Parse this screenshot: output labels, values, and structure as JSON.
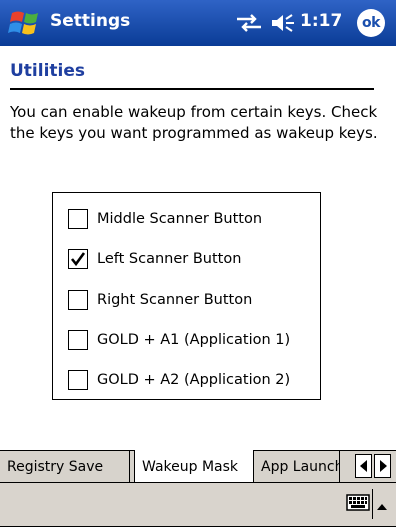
{
  "titlebar": {
    "title": "Settings",
    "clock": "1:17",
    "ok_label": "ok"
  },
  "page": {
    "title": "Utilities",
    "description": "You can enable wakeup from certain keys. Check the keys you want programmed as wakeup keys."
  },
  "wakeup_keys": [
    {
      "label": "Middle Scanner Button",
      "checked": false
    },
    {
      "label": "Left Scanner Button",
      "checked": true
    },
    {
      "label": "Right Scanner Button",
      "checked": false
    },
    {
      "label": "GOLD + A1 (Application 1)",
      "checked": false
    },
    {
      "label": "GOLD + A2 (Application 2)",
      "checked": false
    }
  ],
  "tabs": [
    {
      "label": "Registry Save",
      "active": false
    },
    {
      "label": "Wakeup Mask",
      "active": true
    },
    {
      "label": "App Launch",
      "active": false
    }
  ],
  "menubar": {
    "keyboard_icon": "keyboard-icon",
    "sip_icon": "input-panel-arrow-icon"
  },
  "colors": {
    "title_bar": "#0a3c96",
    "page_title": "#1f3fa0",
    "tab_strip": "#d7d3cc"
  }
}
